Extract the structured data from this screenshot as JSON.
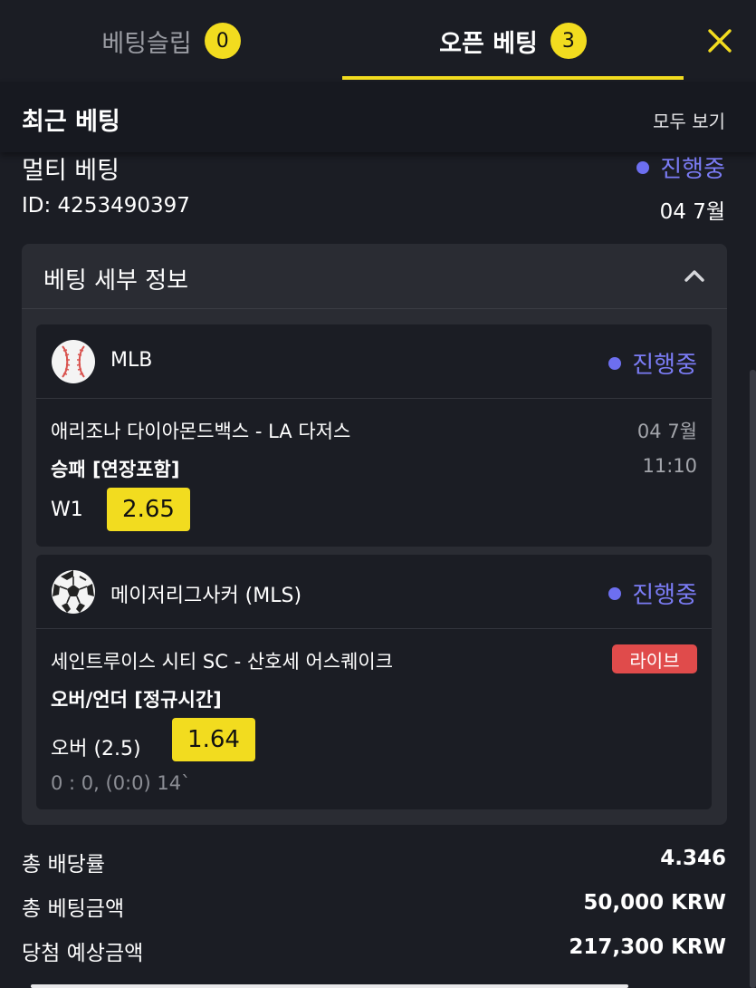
{
  "tabs": {
    "slip_label": "베팅슬립",
    "slip_count": "0",
    "open_label": "오픈 베팅",
    "open_count": "3"
  },
  "icons": {
    "close": "close-icon",
    "chevron": "chevron-up-icon",
    "baseball": "baseball-icon",
    "soccer": "soccer-ball-icon"
  },
  "colors": {
    "accent_yellow": "#f2dc1f",
    "status_purple": "#6d6ff0",
    "live_red": "#e04b4b",
    "background": "#1b1d24"
  },
  "recent": {
    "title": "최근 베팅",
    "view_all": "모두 보기"
  },
  "bet": {
    "type": "멀티 베팅",
    "status": "진행중",
    "id": "ID: 4253490397",
    "date": "04 7월"
  },
  "details": {
    "title": "베팅 세부 정보",
    "events": [
      {
        "league": "MLB",
        "status": "진행중",
        "match": "애리조나 다이아몬드백스 - LA 다저스",
        "market": "승패 [연장포함]",
        "date": "04 7월",
        "time": "11:10",
        "pick": "W1",
        "odds": "2.65"
      },
      {
        "league": "메이저리그사커 (MLS)",
        "status": "진행중",
        "match": "세인트루이스 시티 SC - 산호세 어스퀘이크",
        "market": "오버/언더 [정규시간]",
        "live": "라이브",
        "pick": "오버 (2.5)",
        "odds": "1.64",
        "score": "0 : 0, (0:0) 14`"
      }
    ]
  },
  "summary": {
    "total_odds_label": "총 배당률",
    "total_odds_value": "4.346",
    "stake_label": "총 베팅금액",
    "stake_value": "50,000 KRW",
    "payout_label": "당첨 예상금액",
    "payout_value": "217,300 KRW"
  }
}
